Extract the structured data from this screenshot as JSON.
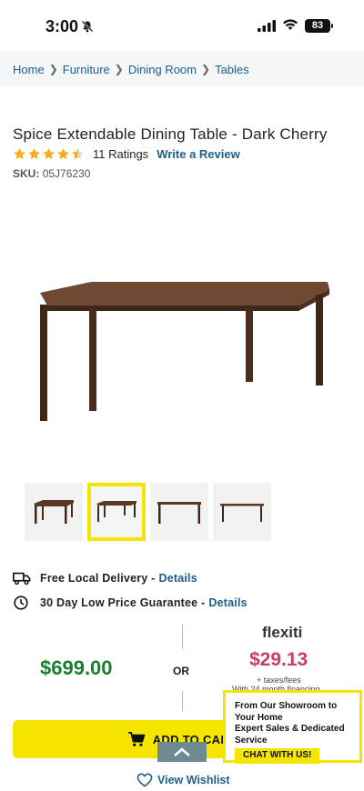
{
  "status_bar": {
    "time": "3:00",
    "battery": "83"
  },
  "breadcrumb": [
    "Home",
    "Furniture",
    "Dining Room",
    "Tables"
  ],
  "product": {
    "title": "Spice Extendable Dining Table - Dark Cherry",
    "rating": 4.5,
    "ratings_count": "11 Ratings",
    "write_review": "Write a Review",
    "sku_label": "SKU:",
    "sku": "05J76230"
  },
  "colors": {
    "accent_yellow": "#f6e500",
    "link_blue": "#1e5f8a",
    "price_green": "#1a7f2e",
    "flexiti_pink": "#c83d6e",
    "star_gold": "#f2b01e"
  },
  "thumbnails": {
    "count": 4,
    "selected_index": 1
  },
  "info": {
    "delivery": {
      "text": "Free Local Delivery -",
      "link": "Details",
      "icon": "truck-icon"
    },
    "guarantee": {
      "text": "30 Day Low Price Guarantee -",
      "link": "Details",
      "icon": "clock-icon"
    }
  },
  "pricing": {
    "price": "$699.00",
    "or": "OR",
    "flexiti_logo": "flexiti",
    "flexiti_price": "$29.13",
    "taxes": "+ taxes/fees",
    "financing": "With 24 month financing"
  },
  "actions": {
    "add_to_cart": "ADD TO CART",
    "wishlist": "View Wishlist"
  },
  "chat": {
    "line1": "From Our Showroom to",
    "line2": "Your Home",
    "line3": "Expert Sales & Dedicated",
    "line4": "Service",
    "button": "CHAT WITH US!"
  }
}
